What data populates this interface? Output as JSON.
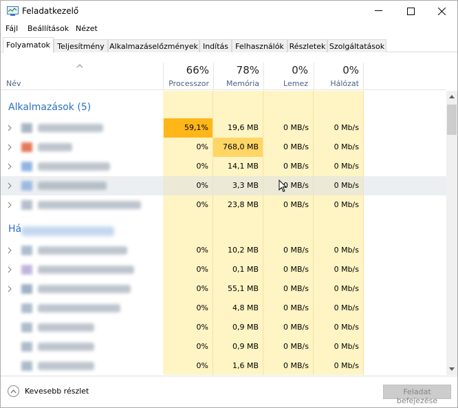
{
  "window": {
    "title": "Feladatkezelő"
  },
  "menu": [
    "Fájl",
    "Beállítások",
    "Nézet"
  ],
  "tabs": [
    "Folyamatok",
    "Teljesítmény",
    "Alkalmazáselőzmények",
    "Indítás",
    "Felhasználók",
    "Részletek",
    "Szolgáltatások"
  ],
  "active_tab": "Folyamatok",
  "columns": {
    "name": "Név",
    "cpu": {
      "pct": "66%",
      "label": "Processzor"
    },
    "mem": {
      "pct": "78%",
      "label": "Memória"
    },
    "disk": {
      "pct": "0%",
      "label": "Lemez"
    },
    "net": {
      "pct": "0%",
      "label": "Hálózat"
    }
  },
  "groups": {
    "apps": "Alkalmazások (5)",
    "background_prefix": "Há"
  },
  "apps": [
    {
      "cpu": "59,1%",
      "mem": "19,6 MB",
      "disk": "0 MB/s",
      "net": "0 Mb/s"
    },
    {
      "cpu": "0%",
      "mem": "768,0 MB",
      "disk": "0 MB/s",
      "net": "0 Mb/s"
    },
    {
      "cpu": "0%",
      "mem": "14,1 MB",
      "disk": "0 MB/s",
      "net": "0 Mb/s"
    },
    {
      "cpu": "0%",
      "mem": "3,3 MB",
      "disk": "0 MB/s",
      "net": "0 Mb/s"
    },
    {
      "cpu": "0%",
      "mem": "23,8 MB",
      "disk": "0 MB/s",
      "net": "0 Mb/s"
    }
  ],
  "background": [
    {
      "cpu": "0%",
      "mem": "10,2 MB",
      "disk": "0 MB/s",
      "net": "0 Mb/s"
    },
    {
      "cpu": "0%",
      "mem": "0,1 MB",
      "disk": "0 MB/s",
      "net": "0 Mb/s"
    },
    {
      "cpu": "0%",
      "mem": "55,1 MB",
      "disk": "0 MB/s",
      "net": "0 Mb/s"
    },
    {
      "cpu": "0%",
      "mem": "4,8 MB",
      "disk": "0 MB/s",
      "net": "0 Mb/s"
    },
    {
      "cpu": "0%",
      "mem": "0,9 MB",
      "disk": "0 MB/s",
      "net": "0 Mb/s"
    },
    {
      "cpu": "0%",
      "mem": "0,9 MB",
      "disk": "0 MB/s",
      "net": "0 Mb/s"
    },
    {
      "cpu": "0%",
      "mem": "1,6 MB",
      "disk": "0 MB/s",
      "net": "0 Mb/s"
    }
  ],
  "footer": {
    "fewer_details": "Kevesebb részlet",
    "end_task": "Feladat befejezése"
  },
  "colors": {
    "accent": "#2b6fc2",
    "heat_low": "#fff4c4",
    "heat_mid": "#ffd666",
    "heat_high": "#ffb619"
  }
}
